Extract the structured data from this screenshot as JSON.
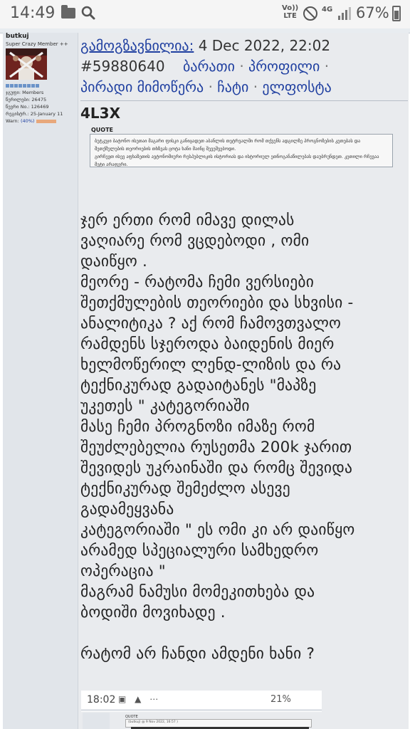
{
  "status_bar": {
    "time": "14:49",
    "net_top": "4G",
    "net_bottom": "LTE",
    "volte_top": "Vo))",
    "volte_bottom": "LTE",
    "battery_percent": "67%",
    "battery_level": 0.67,
    "icons": [
      "folder-icon",
      "search-icon",
      "volte-icon",
      "do-not-disturb-icon",
      "network-icon",
      "signal-icon",
      "battery-icon"
    ]
  },
  "author": {
    "name": "butkuj",
    "rank": "Super Crazy Member ++",
    "group": "ჯგუფი: Members",
    "posts": "წერილები: 26475",
    "number": "წევრი No.: 126469",
    "registered": "რეგისტრ.: 25-January 11",
    "warn_label": "Warn:",
    "warn_value": "(40%)",
    "warn_level": 0.4
  },
  "post": {
    "sent_link": "გამოგზავნილია:",
    "date": "4 Dec 2022, 22:02",
    "post_id": "#59880640",
    "actions": [
      "ბარათი",
      "პროფილი",
      "პირადი მიმოწერა",
      "ჩატი",
      "ელფოსტა"
    ],
    "quoted_nick": "4L3X",
    "quote_label": "QUOTE",
    "quote_text": "ბუტკუჯი ბატონო ისეთაი მაგარი ფისკი განიცადეთ აბანლის თეტრვალში რომ თქვენს ადგილზე პროგნოზების კეთებას და შეთქმულების თეორიების თხზვას ცოტა ხანი მაინც შევეშვებოდი.\nგირჩევთ ისევ აფხაზეთის ავტონომიური რესპუბლიკის ისტორიას და ისტორიულ ეთნოგანაწილებას დაუბრუნდეთ. კეთილი რჩევაა მეტი არაფერი.",
    "body": "ჯერ ერთი რომ იმავე დილას\nვაღიარე რომ ვცდებოდი , ომი\nდაიწყო .\nმეორე - რატომა ჩემი ვერსიები\nშეთქმულების თეორიები და სხვისი -\nანალიტიკა ? აქ რომ ჩამოვთვალო\nრამდენს სჯეროდა ბაიდენის მიერ\nხელმოწერილ ლენდ-ლიზის და რა\nტექნიკურად გადაიტანეს \"მაპზე\nუკეთეს \" კატეგორიაში\nმასე ჩემი პროგნოზი იმაზე რომ\nშეუძლებელია რუსეთმა 200k ჯარით\nშევიდეს უკრაინაში და რომც შევიდა\nტექნიკურად შემეძლო ასევე\nგადამეყვანა\nკატეგორიაში \" ეს ომი კი არ დაიწყო\nარამედ სპეციალური სამხედრო\nოპერაცია \"\nმაგრამ ნამუსი მომეკითხება და\nბოდიში მოვიხადე .\n\nრატომ არ ჩანდი ამდენი ხანი ?"
  },
  "embedded_screenshot": {
    "time": "18:02",
    "icons": "▣ ▲ ⋯",
    "battery": "21%",
    "quote_label": "QUOTE",
    "quote_meta": "(butkuj) @ 9 Nov 2022, 16:57 )"
  }
}
